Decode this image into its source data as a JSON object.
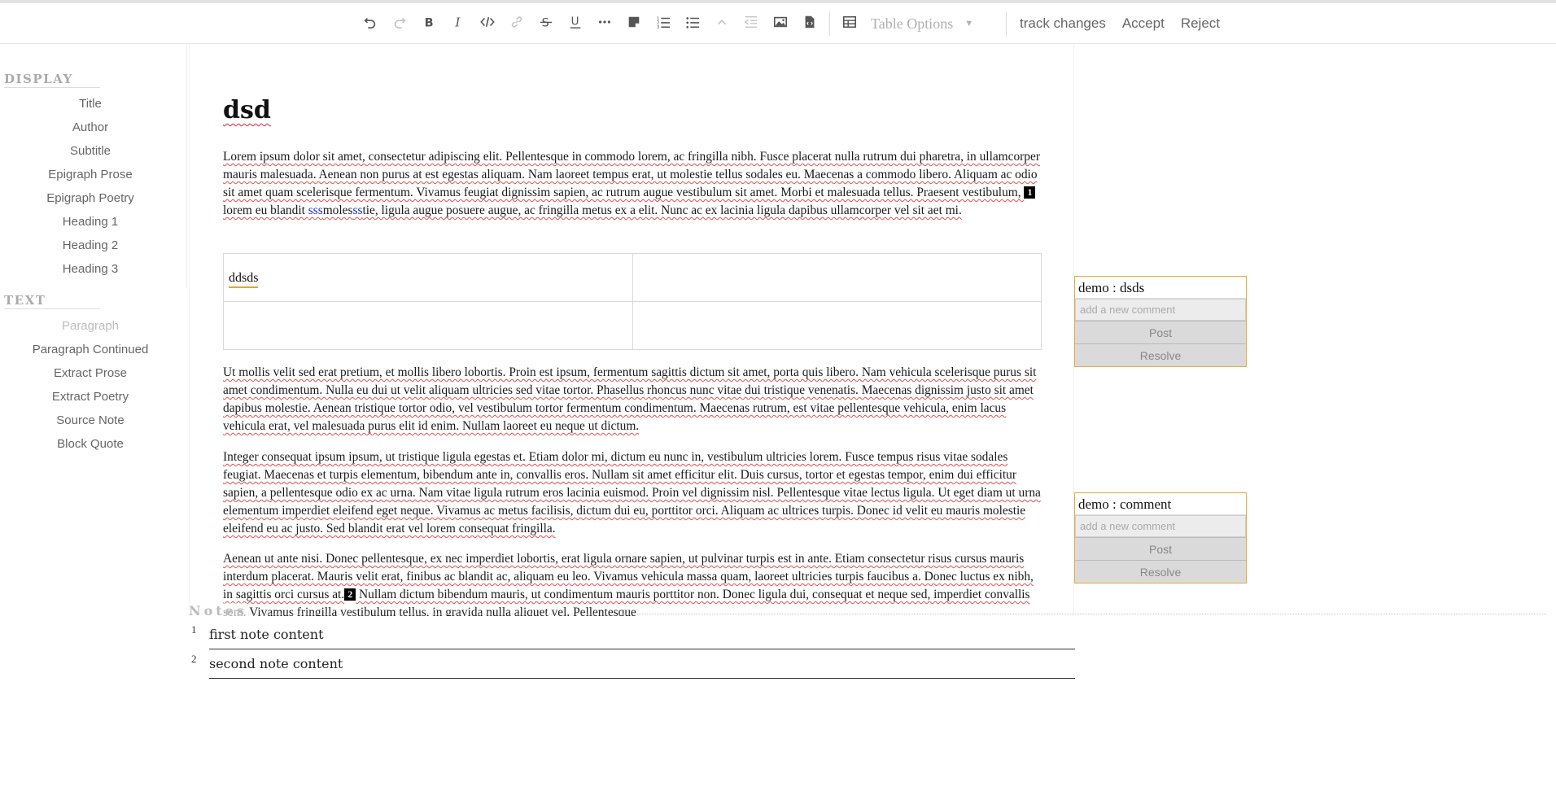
{
  "toolbar": {
    "icons": [
      {
        "name": "undo-icon",
        "glyph": "undo",
        "disabled": false
      },
      {
        "name": "redo-icon",
        "glyph": "redo",
        "disabled": true
      },
      {
        "name": "bold-icon",
        "glyph": "bold",
        "disabled": false
      },
      {
        "name": "italic-icon",
        "glyph": "italic",
        "disabled": false
      },
      {
        "name": "code-icon",
        "glyph": "code",
        "disabled": false
      },
      {
        "name": "link-icon",
        "glyph": "link",
        "disabled": true
      },
      {
        "name": "strikethrough-icon",
        "glyph": "strike",
        "disabled": false
      },
      {
        "name": "underline-icon",
        "glyph": "underline",
        "disabled": false
      },
      {
        "name": "ellipsis-icon",
        "glyph": "ellipsis",
        "disabled": false
      },
      {
        "name": "note-icon",
        "glyph": "note",
        "disabled": false
      },
      {
        "name": "ordered-list-icon",
        "glyph": "ol",
        "disabled": false
      },
      {
        "name": "bullet-list-icon",
        "glyph": "ul",
        "disabled": false
      },
      {
        "name": "lift-icon",
        "glyph": "lift",
        "disabled": true
      },
      {
        "name": "outdent-icon",
        "glyph": "outdent",
        "disabled": true
      },
      {
        "name": "image-icon",
        "glyph": "image",
        "disabled": false
      },
      {
        "name": "file-code-icon",
        "glyph": "filecode",
        "disabled": false
      },
      {
        "name": "table-icon",
        "glyph": "table",
        "disabled": false
      }
    ],
    "table_options": "Table Options",
    "track_changes": "track changes",
    "accept": "Accept",
    "reject": "Reject"
  },
  "sidebar": {
    "display_heading": "DISPLAY",
    "display_items": [
      "Title",
      "Author",
      "Subtitle",
      "Epigraph Prose",
      "Epigraph Poetry",
      "Heading 1",
      "Heading 2",
      "Heading 3"
    ],
    "text_heading": "TEXT",
    "text_items": [
      "Paragraph",
      "Paragraph Continued",
      "Extract Prose",
      "Extract Poetry",
      "Source Note",
      "Block Quote"
    ]
  },
  "document": {
    "title": "dsd",
    "p1_a": "Lorem ipsum dolor sit amet, consectetur adipiscing elit. Pellentesque in commodo lorem, ac fringilla nibh. Fusce placerat nulla rutrum dui pharetra, in ullamcorper mauris malesuada. Aenean non purus at est egestas aliquam. Nam laoreet tempus erat, ut molestie tellus sodales eu. Maecenas a commodo libero. Aliquam ac odio sit amet quam scelerisque fermentum. Vivamus feugiat dignissim sapien, ac rutrum augue vestibulum sit amet. Morbi et malesuada tellus. Praesent vestibulum, ",
    "p1_marker": "1",
    "p1_b": "lorem eu blandit ",
    "p1_ins1": "sss",
    "p1_c": "moles",
    "p1_ins2": "ss",
    "p1_d": "tie, ligula augue posuere augue, ac fringilla metus ex a elit. Nunc ac ex lacinia ligula dapibus ullamcorper vel sit aet mi.",
    "table_cell": "ddsds",
    "p2": "Ut mollis velit sed erat pretium, et mollis libero lobortis. Proin est ipsum, fermentum sagittis dictum sit amet, porta quis libero. Nam vehicula scelerisque purus sit amet condimentum. Nulla eu dui ut velit aliquam ultricies sed vitae tortor. Phasellus rhoncus nunc vitae dui tristique venenatis. Maecenas dignissim justo sit amet dapibus molestie. Aenean tristique tortor odio, vel vestibulum tortor fermentum condimentum. Maecenas rutrum, est vitae pellentesque vehicula, enim lacus vehicula erat, vel malesuada purus elit id enim. Nullam laoreet eu neque ut dictum.",
    "p3": "Integer consequat ipsum ipsum, ut tristique ligula egestas et. Etiam dolor mi, dictum eu nunc in, vestibulum ultricies lorem. Fusce tempus risus vitae sodales feugiat. Maecenas et turpis elementum, bibendum ante in, convallis eros. Nullam sit amet efficitur elit. Duis cursus, tortor et egestas tempor, enim dui efficitur sapien, a pellentesque odio ex ac urna. Nam vitae ligula rutrum eros lacinia euismod. Proin vel dignissim nisl. Pellentesque vitae lectus ligula. Ut eget diam ut urna elementum imperdiet eleifend eget neque. Vivamus ac metus facilisis, dictum dui eu, porttitor orci. Aliquam ac ultrices turpis. Donec id velit eu mauris molestie eleifend eu ac justo. Sed blandit erat vel lorem consequat fringilla.",
    "p4_a": "Aenean ut ante nisi. Donec pellentesque, ex nec imperdiet lobortis, erat ligula ornare sapien, ut pulvinar turpis est in ante. Etiam consectetur risus cursus mauris interdum placerat. Mauris velit erat, finibus ac blandit ac, aliquam eu leo. Vivamus vehicula massa quam, laoreet ultricies turpis faucibus a. Donec luctus ex nibh, in sagittis orci cursus at.",
    "p4_marker": "2",
    "p4_b": " Nullam dictum bibendum mauris, ut condimentum mauris porttitor non. Donec ligula dui, consequat et neque sed, imperdiet convallis sem. Vivamus fringilla vestibulum tellus, in gravida nulla aliquet vel. Pellentesque"
  },
  "comments": [
    {
      "header": "demo : dsds",
      "placeholder": "add a new comment",
      "post": "Post",
      "resolve": "Resolve"
    },
    {
      "header": "demo : comment",
      "placeholder": "add a new comment",
      "post": "Post",
      "resolve": "Resolve"
    }
  ],
  "notes": {
    "label": "Notes",
    "items": [
      {
        "number": "1",
        "text": "first note content"
      },
      {
        "number": "2",
        "text": "second note content"
      }
    ]
  },
  "colors": {
    "comment_border": "#f0a93a",
    "insertion": "#1f2fd0",
    "spellcheck": "#e05050"
  }
}
